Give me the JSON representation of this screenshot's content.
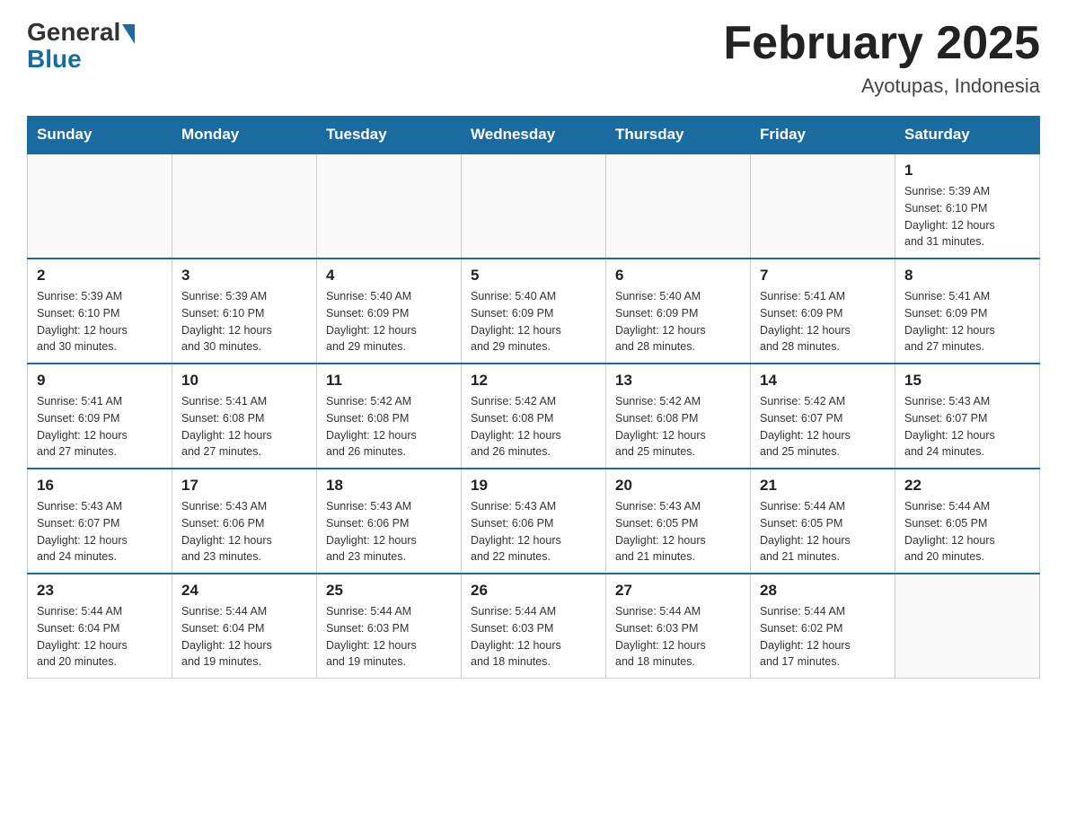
{
  "header": {
    "logo_general": "General",
    "logo_blue": "Blue",
    "month_title": "February 2025",
    "location": "Ayotupas, Indonesia"
  },
  "days_of_week": [
    "Sunday",
    "Monday",
    "Tuesday",
    "Wednesday",
    "Thursday",
    "Friday",
    "Saturday"
  ],
  "weeks": [
    [
      {
        "day": "",
        "info": ""
      },
      {
        "day": "",
        "info": ""
      },
      {
        "day": "",
        "info": ""
      },
      {
        "day": "",
        "info": ""
      },
      {
        "day": "",
        "info": ""
      },
      {
        "day": "",
        "info": ""
      },
      {
        "day": "1",
        "info": "Sunrise: 5:39 AM\nSunset: 6:10 PM\nDaylight: 12 hours\nand 31 minutes."
      }
    ],
    [
      {
        "day": "2",
        "info": "Sunrise: 5:39 AM\nSunset: 6:10 PM\nDaylight: 12 hours\nand 30 minutes."
      },
      {
        "day": "3",
        "info": "Sunrise: 5:39 AM\nSunset: 6:10 PM\nDaylight: 12 hours\nand 30 minutes."
      },
      {
        "day": "4",
        "info": "Sunrise: 5:40 AM\nSunset: 6:09 PM\nDaylight: 12 hours\nand 29 minutes."
      },
      {
        "day": "5",
        "info": "Sunrise: 5:40 AM\nSunset: 6:09 PM\nDaylight: 12 hours\nand 29 minutes."
      },
      {
        "day": "6",
        "info": "Sunrise: 5:40 AM\nSunset: 6:09 PM\nDaylight: 12 hours\nand 28 minutes."
      },
      {
        "day": "7",
        "info": "Sunrise: 5:41 AM\nSunset: 6:09 PM\nDaylight: 12 hours\nand 28 minutes."
      },
      {
        "day": "8",
        "info": "Sunrise: 5:41 AM\nSunset: 6:09 PM\nDaylight: 12 hours\nand 27 minutes."
      }
    ],
    [
      {
        "day": "9",
        "info": "Sunrise: 5:41 AM\nSunset: 6:09 PM\nDaylight: 12 hours\nand 27 minutes."
      },
      {
        "day": "10",
        "info": "Sunrise: 5:41 AM\nSunset: 6:08 PM\nDaylight: 12 hours\nand 27 minutes."
      },
      {
        "day": "11",
        "info": "Sunrise: 5:42 AM\nSunset: 6:08 PM\nDaylight: 12 hours\nand 26 minutes."
      },
      {
        "day": "12",
        "info": "Sunrise: 5:42 AM\nSunset: 6:08 PM\nDaylight: 12 hours\nand 26 minutes."
      },
      {
        "day": "13",
        "info": "Sunrise: 5:42 AM\nSunset: 6:08 PM\nDaylight: 12 hours\nand 25 minutes."
      },
      {
        "day": "14",
        "info": "Sunrise: 5:42 AM\nSunset: 6:07 PM\nDaylight: 12 hours\nand 25 minutes."
      },
      {
        "day": "15",
        "info": "Sunrise: 5:43 AM\nSunset: 6:07 PM\nDaylight: 12 hours\nand 24 minutes."
      }
    ],
    [
      {
        "day": "16",
        "info": "Sunrise: 5:43 AM\nSunset: 6:07 PM\nDaylight: 12 hours\nand 24 minutes."
      },
      {
        "day": "17",
        "info": "Sunrise: 5:43 AM\nSunset: 6:06 PM\nDaylight: 12 hours\nand 23 minutes."
      },
      {
        "day": "18",
        "info": "Sunrise: 5:43 AM\nSunset: 6:06 PM\nDaylight: 12 hours\nand 23 minutes."
      },
      {
        "day": "19",
        "info": "Sunrise: 5:43 AM\nSunset: 6:06 PM\nDaylight: 12 hours\nand 22 minutes."
      },
      {
        "day": "20",
        "info": "Sunrise: 5:43 AM\nSunset: 6:05 PM\nDaylight: 12 hours\nand 21 minutes."
      },
      {
        "day": "21",
        "info": "Sunrise: 5:44 AM\nSunset: 6:05 PM\nDaylight: 12 hours\nand 21 minutes."
      },
      {
        "day": "22",
        "info": "Sunrise: 5:44 AM\nSunset: 6:05 PM\nDaylight: 12 hours\nand 20 minutes."
      }
    ],
    [
      {
        "day": "23",
        "info": "Sunrise: 5:44 AM\nSunset: 6:04 PM\nDaylight: 12 hours\nand 20 minutes."
      },
      {
        "day": "24",
        "info": "Sunrise: 5:44 AM\nSunset: 6:04 PM\nDaylight: 12 hours\nand 19 minutes."
      },
      {
        "day": "25",
        "info": "Sunrise: 5:44 AM\nSunset: 6:03 PM\nDaylight: 12 hours\nand 19 minutes."
      },
      {
        "day": "26",
        "info": "Sunrise: 5:44 AM\nSunset: 6:03 PM\nDaylight: 12 hours\nand 18 minutes."
      },
      {
        "day": "27",
        "info": "Sunrise: 5:44 AM\nSunset: 6:03 PM\nDaylight: 12 hours\nand 18 minutes."
      },
      {
        "day": "28",
        "info": "Sunrise: 5:44 AM\nSunset: 6:02 PM\nDaylight: 12 hours\nand 17 minutes."
      },
      {
        "day": "",
        "info": ""
      }
    ]
  ]
}
